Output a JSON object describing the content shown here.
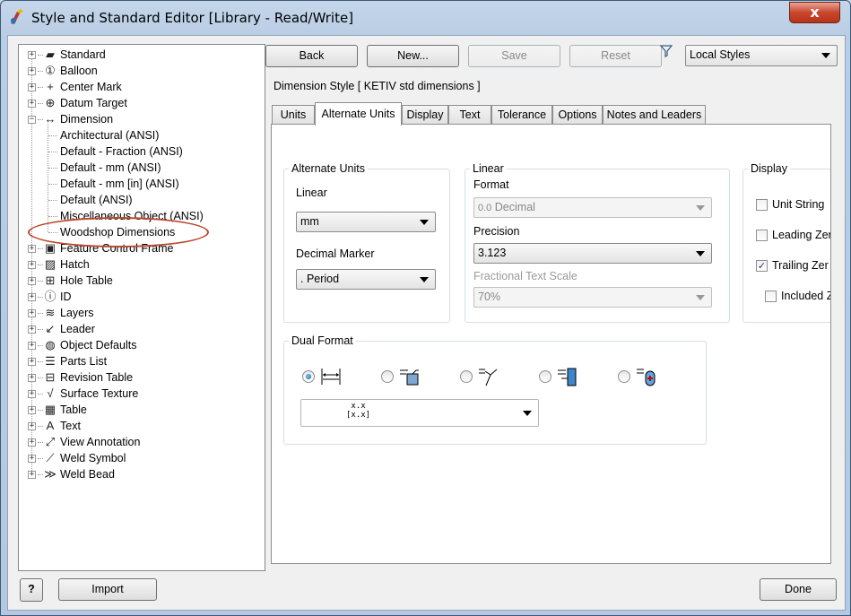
{
  "window": {
    "title": "Style and Standard Editor [Library - Read/Write]",
    "close_glyph": "x"
  },
  "tree": {
    "items": [
      {
        "label": "Standard",
        "icon": "standard-icon",
        "glyph": "▰",
        "level": 0,
        "expander": "+"
      },
      {
        "label": "Balloon",
        "icon": "balloon-icon",
        "glyph": "①",
        "level": 0,
        "expander": "+"
      },
      {
        "label": "Center Mark",
        "icon": "center-mark-icon",
        "glyph": "+",
        "level": 0,
        "expander": "+"
      },
      {
        "label": "Datum Target",
        "icon": "datum-target-icon",
        "glyph": "⊕",
        "level": 0,
        "expander": "+"
      },
      {
        "label": "Dimension",
        "icon": "dimension-icon",
        "glyph": "↔",
        "level": 0,
        "expander": "−"
      },
      {
        "label": "Architectural (ANSI)",
        "level": 1
      },
      {
        "label": "Default - Fraction (ANSI)",
        "level": 1
      },
      {
        "label": "Default - mm (ANSI)",
        "level": 1
      },
      {
        "label": "Default - mm [in] (ANSI)",
        "level": 1
      },
      {
        "label": "Default (ANSI)",
        "level": 1
      },
      {
        "label": "Miscellaneous Object (ANSI)",
        "level": 1
      },
      {
        "label": "Woodshop Dimensions",
        "level": 1
      },
      {
        "label": "Feature Control Frame",
        "icon": "feature-control-frame-icon",
        "glyph": "▣",
        "level": 0,
        "expander": "+"
      },
      {
        "label": "Hatch",
        "icon": "hatch-icon",
        "glyph": "▨",
        "level": 0,
        "expander": "+"
      },
      {
        "label": "Hole Table",
        "icon": "hole-table-icon",
        "glyph": "⊞",
        "level": 0,
        "expander": "+"
      },
      {
        "label": "ID",
        "icon": "id-icon",
        "glyph": "ⓘ",
        "level": 0,
        "expander": "+"
      },
      {
        "label": "Layers",
        "icon": "layers-icon",
        "glyph": "≋",
        "level": 0,
        "expander": "+"
      },
      {
        "label": "Leader",
        "icon": "leader-icon",
        "glyph": "↙",
        "level": 0,
        "expander": "+"
      },
      {
        "label": "Object Defaults",
        "icon": "object-defaults-icon",
        "glyph": "◍",
        "level": 0,
        "expander": "+"
      },
      {
        "label": "Parts List",
        "icon": "parts-list-icon",
        "glyph": "☰",
        "level": 0,
        "expander": "+"
      },
      {
        "label": "Revision Table",
        "icon": "revision-table-icon",
        "glyph": "⊟",
        "level": 0,
        "expander": "+"
      },
      {
        "label": "Surface Texture",
        "icon": "surface-texture-icon",
        "glyph": "√",
        "level": 0,
        "expander": "+"
      },
      {
        "label": "Table",
        "icon": "table-icon",
        "glyph": "▦",
        "level": 0,
        "expander": "+"
      },
      {
        "label": "Text",
        "icon": "text-icon",
        "glyph": "A",
        "level": 0,
        "expander": "+"
      },
      {
        "label": "View Annotation",
        "icon": "view-annotation-icon",
        "glyph": "⤢",
        "level": 0,
        "expander": "+"
      },
      {
        "label": "Weld Symbol",
        "icon": "weld-symbol-icon",
        "glyph": "⟋",
        "level": 0,
        "expander": "+"
      },
      {
        "label": "Weld Bead",
        "icon": "weld-bead-icon",
        "glyph": "≫",
        "level": 0,
        "expander": "+"
      }
    ]
  },
  "toolbar": {
    "back": "Back",
    "new": "New...",
    "save": "Save",
    "reset": "Reset",
    "filter_selected": "Local Styles"
  },
  "style_header": "Dimension Style [ KETIV std dimensions ]",
  "tabs": [
    "Units",
    "Alternate Units",
    "Display",
    "Text",
    "Tolerance",
    "Options",
    "Notes and Leaders"
  ],
  "active_tab": "Alternate Units",
  "alternate_units": {
    "title": "Alternate Units",
    "linear_label": "Linear",
    "linear_value": "mm",
    "decimal_marker_label": "Decimal Marker",
    "decimal_marker_value": ". Period"
  },
  "linear": {
    "title": "Linear",
    "format_label": "Format",
    "format_prefix": "0.0",
    "format_value": "Decimal",
    "precision_label": "Precision",
    "precision_value": "3.123",
    "fractional_text_scale_label": "Fractional Text Scale",
    "fractional_text_scale_value": "70%"
  },
  "display": {
    "title": "Display",
    "unit_string": {
      "label": "Unit String",
      "checked": false
    },
    "leading_zeros": {
      "label": "Leading Zer",
      "checked": false
    },
    "trailing_zeros": {
      "label": "Trailing Zer",
      "checked": true
    },
    "included_zeros": {
      "label": "Included Z",
      "checked": false
    },
    "check_glyph": "✓"
  },
  "dual_format": {
    "title": "Dual Format",
    "options": [
      "dual-inline-icon",
      "dual-box-icon",
      "dual-branch-icon",
      "dual-stacked-icon",
      "dual-bubble-icon"
    ],
    "selected_index": 0,
    "preview_line1": "x.x",
    "preview_line2": "[x.x]"
  },
  "footer": {
    "help": "?",
    "import": "Import",
    "done": "Done"
  },
  "colors": {
    "highlight_ellipse": "#b84a30",
    "close_button": "#c9462d"
  }
}
